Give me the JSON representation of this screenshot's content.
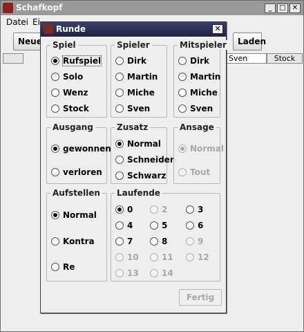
{
  "window": {
    "title": "Schafkopf"
  },
  "menu": {
    "file": "Datei",
    "settings_partial": "Ei"
  },
  "toolbar": {
    "new_partial": "Neue",
    "load": "Laden"
  },
  "table_header": [
    "Sven",
    "Stock"
  ],
  "dialog": {
    "title": "Runde",
    "close": "✕",
    "spiel": {
      "title": "Spiel",
      "options": [
        "Rufspiel",
        "Solo",
        "Wenz",
        "Stock"
      ],
      "selected": 0
    },
    "spieler": {
      "title": "Spieler",
      "options": [
        "Dirk",
        "Martin",
        "Miche",
        "Sven"
      ]
    },
    "mitspieler": {
      "title": "Mitspieler",
      "options": [
        "Dirk",
        "Martin",
        "Miche",
        "Sven"
      ]
    },
    "ausgang": {
      "title": "Ausgang",
      "options": [
        "gewonnen",
        "verloren"
      ],
      "selected": 0
    },
    "zusatz": {
      "title": "Zusatz",
      "options": [
        "Normal",
        "Schneider",
        "Schwarz"
      ],
      "selected": 0
    },
    "ansage": {
      "title": "Ansage",
      "options": [
        "Normal",
        "Tout"
      ],
      "selected": 0,
      "enabled": false
    },
    "aufstellen": {
      "title": "Aufstellen",
      "options": [
        "Normal",
        "Kontra",
        "Re"
      ],
      "selected": 0
    },
    "laufende": {
      "title": "Laufende",
      "options": [
        "0",
        "2",
        "3",
        "4",
        "5",
        "6",
        "7",
        "8",
        "9",
        "10",
        "11",
        "12",
        "13",
        "14"
      ],
      "selected": 0
    },
    "done": "Fertig"
  }
}
